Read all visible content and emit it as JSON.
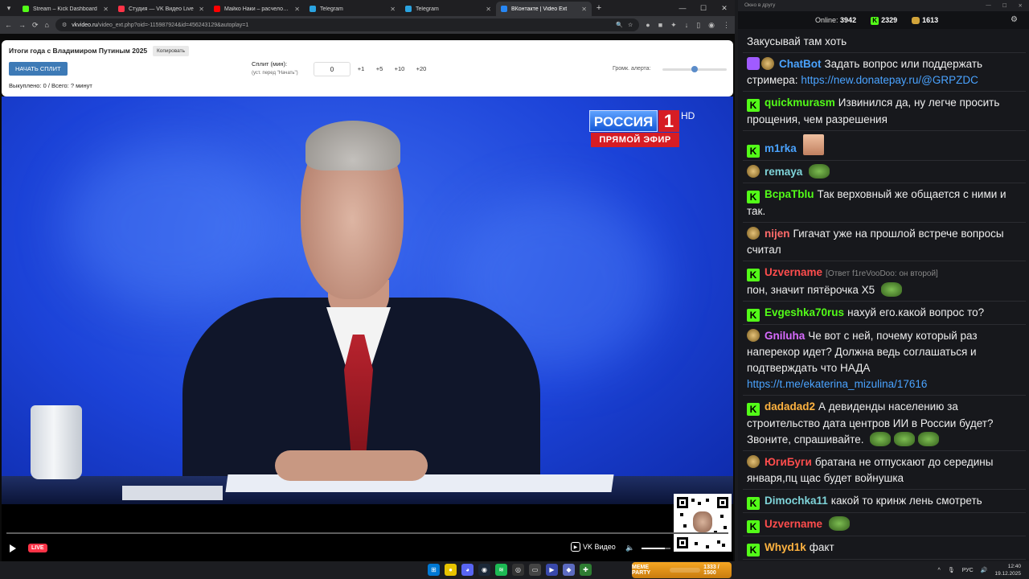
{
  "browser": {
    "tabs": [
      {
        "label": "Stream – Kick Dashboard",
        "color": "#53fc18",
        "active": false
      },
      {
        "label": "Студия — VK Видео Live",
        "color": "#ff3347",
        "active": false
      },
      {
        "label": "Майко Наки – расчеловечили...",
        "color": "#ff0000",
        "active": false
      },
      {
        "label": "Telegram",
        "color": "#2aa3e0",
        "active": false
      },
      {
        "label": "Telegram",
        "color": "#2aa3e0",
        "active": false
      },
      {
        "label": "ВКонтакте | Video Ext",
        "color": "#2787f5",
        "active": true
      }
    ],
    "url_host": "vkvideo.ru",
    "url_path": "/video_ext.php?oid=-115987924&id=456243129&autoplay=1"
  },
  "controls": {
    "title": "Итоги года с Владимиром Путиным 2025",
    "copy_label": "Копировать",
    "start_label": "НАЧАТЬ СПЛИТ",
    "counter": "Выкуплено: 0 / Всего: ? минут",
    "split_label": "Сплит (мин):",
    "split_sub": "(уст. перед \"Начать\")",
    "split_value": "0",
    "steps": [
      "+1",
      "+5",
      "+10",
      "+20"
    ],
    "alert_label": "Громк. алерта:",
    "alert_level": 0.5
  },
  "player": {
    "channel_logo": "РОССИЯ",
    "channel_num": "1",
    "hd": "HD",
    "live_banner": "ПРЯМОЙ ЭФИР",
    "live_badge": "LIVE",
    "brand": "VK Видео",
    "volume": 0.8
  },
  "chat": {
    "window_title": "Окно в другу",
    "online_label": "Online:",
    "online": "3942",
    "kick_count": "2329",
    "gold_count": "1613",
    "messages": [
      {
        "badge": "none",
        "user": "",
        "color": "#ffffff",
        "note": "",
        "text": "Закусывай там хоть",
        "link": ""
      },
      {
        "badge": "bot",
        "user": "ChatBot",
        "color": "#4aa3ff",
        "note": "",
        "text": "Задать вопрос или поддержать стримера:",
        "link": "https://new.donatepay.ru/@GRPZDC",
        "emotes": 0
      },
      {
        "badge": "k",
        "user": "quickmurasm",
        "color": "#53fc18",
        "note": "",
        "text": "Извинился да, ну легче просить прощения, чем разрешения",
        "link": "",
        "emotes": 0
      },
      {
        "badge": "k",
        "user": "m1rka",
        "color": "#4aa3ff",
        "note": "",
        "text": "",
        "link": "",
        "emotes": 1,
        "emote_kind": "pic"
      },
      {
        "badge": "mask",
        "user": "remaya",
        "color": "#7fd4d9",
        "note": "",
        "text": "",
        "link": "",
        "emotes": 1
      },
      {
        "badge": "k",
        "user": "BcpaTblu",
        "color": "#53fc18",
        "note": "",
        "text": "Так верховный же общается с ними и так.",
        "link": "",
        "emotes": 0
      },
      {
        "badge": "mask",
        "user": "nijen",
        "color": "#ff6b6b",
        "note": "",
        "text": "Гигачат уже на прошлой встрече вопросы считал",
        "link": "",
        "emotes": 0
      },
      {
        "badge": "k",
        "user": "Uzvername",
        "color": "#ff4d4d",
        "note": "[Ответ f1reVooDoo: он второй]",
        "text": "пон, значит пятёрочка X5",
        "link": "",
        "emotes": 1
      },
      {
        "badge": "k",
        "user": "Evgeshka70rus",
        "color": "#53fc18",
        "note": "",
        "text": "нахуй его.какой вопрос то?",
        "link": "",
        "emotes": 0
      },
      {
        "badge": "mask",
        "user": "Gniluha",
        "color": "#d86bff",
        "note": "",
        "text": "Че вот с ней, почему который раз наперекор идет? Должна ведь соглашаться и подтверждать что НАДА",
        "link": "https://t.me/ekaterina_mizulina/17616",
        "emotes": 0
      },
      {
        "badge": "k",
        "user": "dadadad2",
        "color": "#ffb340",
        "note": "",
        "text": "А девиденды населению за строительство дата центров ИИ в России будет? Звоните, спрашивайте.",
        "link": "",
        "emotes": 3
      },
      {
        "badge": "mask",
        "user": "ЮгиБуги",
        "color": "#ff4d4d",
        "note": "",
        "text": "братана не отпускают до середины января,пц щас будет войнушка",
        "link": "",
        "emotes": 0
      },
      {
        "badge": "k",
        "user": "Dimochka11",
        "color": "#7fd4d9",
        "note": "",
        "text": "какой то кринж лень смотреть",
        "link": "",
        "emotes": 0
      },
      {
        "badge": "k",
        "user": "Uzvername",
        "color": "#ff4d4d",
        "note": "",
        "text": "",
        "link": "",
        "emotes": 1
      },
      {
        "badge": "k",
        "user": "Whyd1k",
        "color": "#ffb340",
        "note": "",
        "text": "факт",
        "link": "",
        "emotes": 0
      }
    ]
  },
  "taskbar": {
    "meme_label": "MEME PARTY",
    "meme_value": "1333 / 1500",
    "lang": "РУС",
    "time": "12:40",
    "date": "19.12.2025"
  }
}
